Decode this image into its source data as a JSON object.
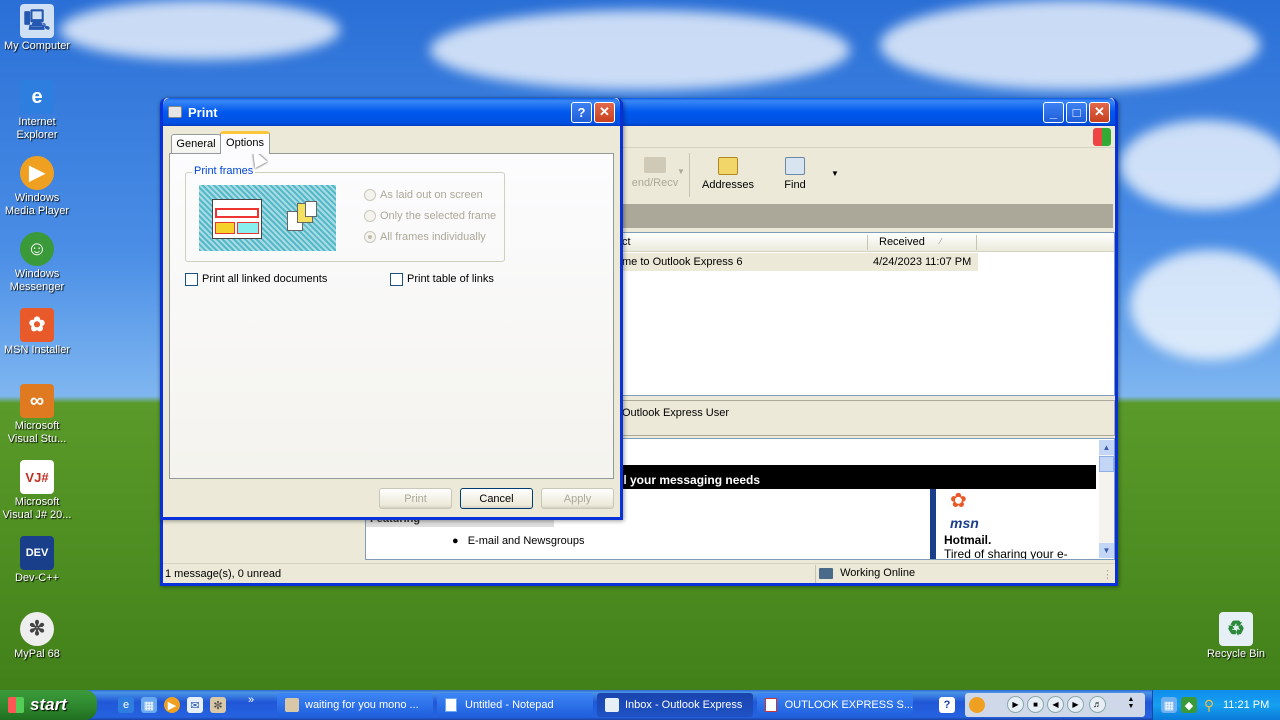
{
  "desktop": {
    "icons": [
      {
        "label": "My Computer"
      },
      {
        "label": "Internet Explorer"
      },
      {
        "label": "Windows Media Player"
      },
      {
        "label": "Windows Messenger"
      },
      {
        "label": "MSN Installer"
      },
      {
        "label": "Microsoft Visual Stu..."
      },
      {
        "label": "Microsoft Visual J# 20..."
      },
      {
        "label": "Dev-C++"
      },
      {
        "label": "MyPal 68"
      },
      {
        "label": "Recycle Bin"
      }
    ]
  },
  "outlook": {
    "toolbar": {
      "send_recv": "end/Recv",
      "addresses": "Addresses",
      "find": "Find"
    },
    "columns": {
      "subject": "ct",
      "received": "Received"
    },
    "messages": [
      {
        "subject": "me to Outlook Express 6",
        "received": "4/24/2023 11:07 PM"
      }
    ],
    "preview": {
      "to": "Outlook Express User",
      "banner": "ll your messaging needs",
      "featuring": "Featuring",
      "bullet": "E-mail and Newsgroups",
      "msn": "msn",
      "hotmail": "Hotmail.",
      "tired": "Tired of sharing your e-"
    },
    "status": {
      "count": "1 message(s), 0 unread",
      "online": "Working Online"
    }
  },
  "print_dialog": {
    "title": "Print",
    "tabs": [
      {
        "label": "General"
      },
      {
        "label": "Options"
      }
    ],
    "print_frames": {
      "legend": "Print frames",
      "options": [
        {
          "label": "As laid out on screen"
        },
        {
          "label": "Only the selected frame"
        },
        {
          "label": "All frames individually"
        }
      ]
    },
    "print_linked": "Print all linked documents",
    "print_table": "Print table of links",
    "buttons": {
      "print": "Print",
      "cancel": "Cancel",
      "apply": "Apply"
    }
  },
  "taskbar": {
    "start": "start",
    "tasks": [
      {
        "label": "waiting for you mono ..."
      },
      {
        "label": "Untitled - Notepad"
      },
      {
        "label": "Inbox - Outlook Express"
      },
      {
        "label": "OUTLOOK EXPRESS S..."
      }
    ],
    "clock": "11:21 PM"
  }
}
